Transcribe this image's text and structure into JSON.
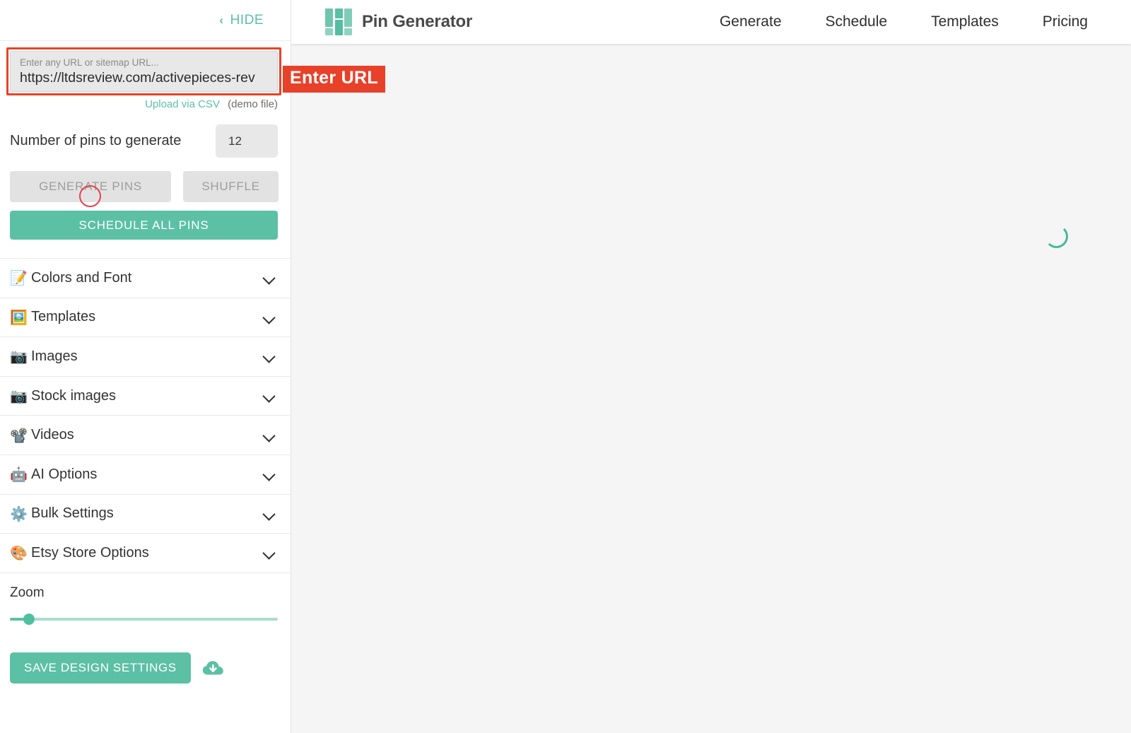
{
  "sidebar": {
    "hide_button": {
      "label": "HIDE",
      "icon": "chevron-left-icon"
    },
    "url_input": {
      "placeholder": "Enter any URL or sitemap URL...",
      "value": "https://ltdsreview.com/activepieces-rev",
      "highlight_color": "#ea4226"
    },
    "csv": {
      "link_label": "Upload via CSV",
      "demo_label": "(demo file)"
    },
    "pins": {
      "label": "Number of pins to generate",
      "value": "12"
    },
    "buttons": {
      "generate": "GENERATE PINS",
      "shuffle": "SHUFFLE",
      "schedule": "SCHEDULE ALL PINS",
      "save_design": "SAVE DESIGN SETTINGS"
    },
    "sections": [
      {
        "emoji": "📝",
        "label": "Colors and Font",
        "icon": "memo-icon"
      },
      {
        "emoji": "🖼️",
        "label": "Templates",
        "icon": "framed-picture-icon"
      },
      {
        "emoji": "📷",
        "label": "Images",
        "icon": "camera-icon"
      },
      {
        "emoji": "📷",
        "label": "Stock images",
        "icon": "camera-icon"
      },
      {
        "emoji": "📽️",
        "label": "Videos",
        "icon": "film-projector-icon"
      },
      {
        "emoji": "🤖",
        "label": "AI Options",
        "icon": "robot-icon"
      },
      {
        "emoji": "⚙️",
        "label": "Bulk Settings",
        "icon": "gear-icon"
      },
      {
        "emoji": "🎨",
        "label": "Etsy Store Options",
        "icon": "palette-icon"
      }
    ],
    "zoom": {
      "label": "Zoom",
      "value": 7
    }
  },
  "annotation": {
    "label": "Enter URL",
    "color": "#e8412a"
  },
  "header": {
    "brand": "Pin Generator",
    "nav": [
      {
        "label": "Generate"
      },
      {
        "label": "Schedule"
      },
      {
        "label": "Templates"
      },
      {
        "label": "Pricing"
      }
    ]
  },
  "main": {
    "status": "loading",
    "spinner_color": "#45b99b",
    "background": "#f5f5f5"
  },
  "theme": {
    "accent": "#5cc0a5",
    "accent_light": "#a9ddcd",
    "alert": "#e8412a",
    "marker": "#e8404f"
  }
}
